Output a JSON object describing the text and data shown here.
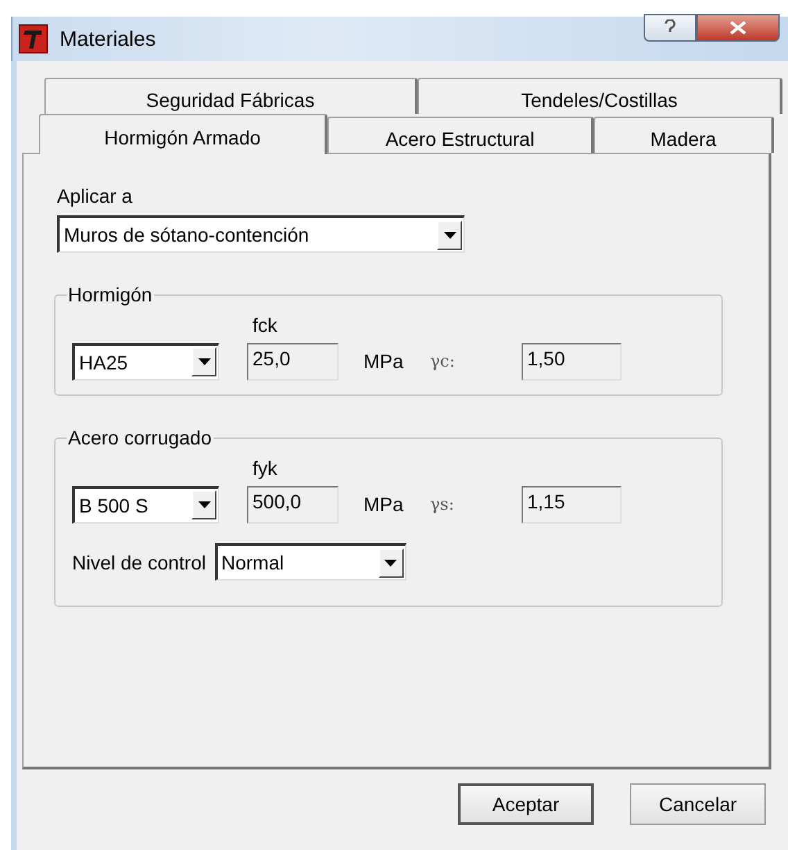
{
  "window": {
    "title": "Materiales"
  },
  "tab_rows": [
    [
      {
        "label": "Seguridad Fábricas",
        "selected": false
      },
      {
        "label": "Tendeles/Costillas",
        "selected": false
      }
    ],
    [
      {
        "label": "Hormigón Armado",
        "selected": true
      },
      {
        "label": "Acero Estructural",
        "selected": false
      },
      {
        "label": "Madera",
        "selected": false
      }
    ]
  ],
  "apply_to": {
    "label": "Aplicar a",
    "value": "Muros de sótano-contención"
  },
  "groups": [
    {
      "title": "Hormigón",
      "strength_label": "fck",
      "type_value": "HA25",
      "strength_value": "25,0",
      "unit": "MPa",
      "factor_label": "γc:",
      "factor_value": "1,50"
    },
    {
      "title": "Acero corrugado",
      "strength_label": "fyk",
      "type_value": "B 500 S",
      "strength_value": "500,0",
      "unit": "MPa",
      "factor_label": "γs:",
      "factor_value": "1,15",
      "control": {
        "label": "Nivel de control",
        "value": "Normal"
      }
    }
  ],
  "buttons": [
    {
      "label": "Aceptar",
      "default": true
    },
    {
      "label": "Cancelar",
      "default": false
    }
  ]
}
